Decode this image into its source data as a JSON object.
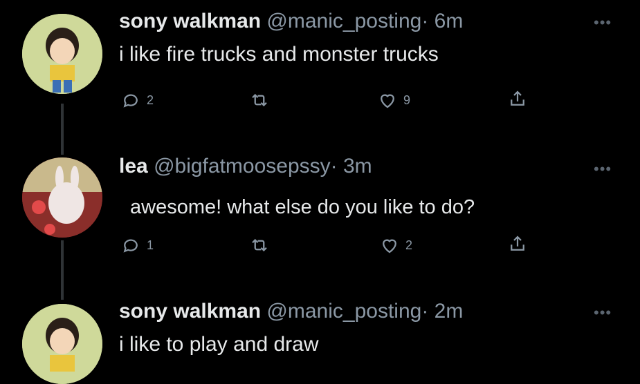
{
  "tweets": [
    {
      "name": "sony walkman",
      "handle": "@manic_posting",
      "time": "· 6m",
      "text": "i like fire trucks and monster trucks",
      "replies": "2",
      "retweets": "",
      "likes": "9"
    },
    {
      "name": "lea",
      "handle": "@bigfatmoosepssy",
      "time": "· 3m",
      "text": "awesome! what else do you like to do?",
      "replies": "1",
      "retweets": "",
      "likes": "2"
    },
    {
      "name": "sony walkman",
      "handle": "@manic_posting",
      "time": "· 2m",
      "text": "i like to play and draw"
    }
  ],
  "icons": {
    "reply": "reply-icon",
    "retweet": "retweet-icon",
    "like": "heart-icon",
    "share": "share-icon",
    "more": "more-icon"
  },
  "colors": {
    "background": "#000000",
    "text": "#e7e9ea",
    "muted": "#8b98a5",
    "thread_line": "#2f3336"
  }
}
